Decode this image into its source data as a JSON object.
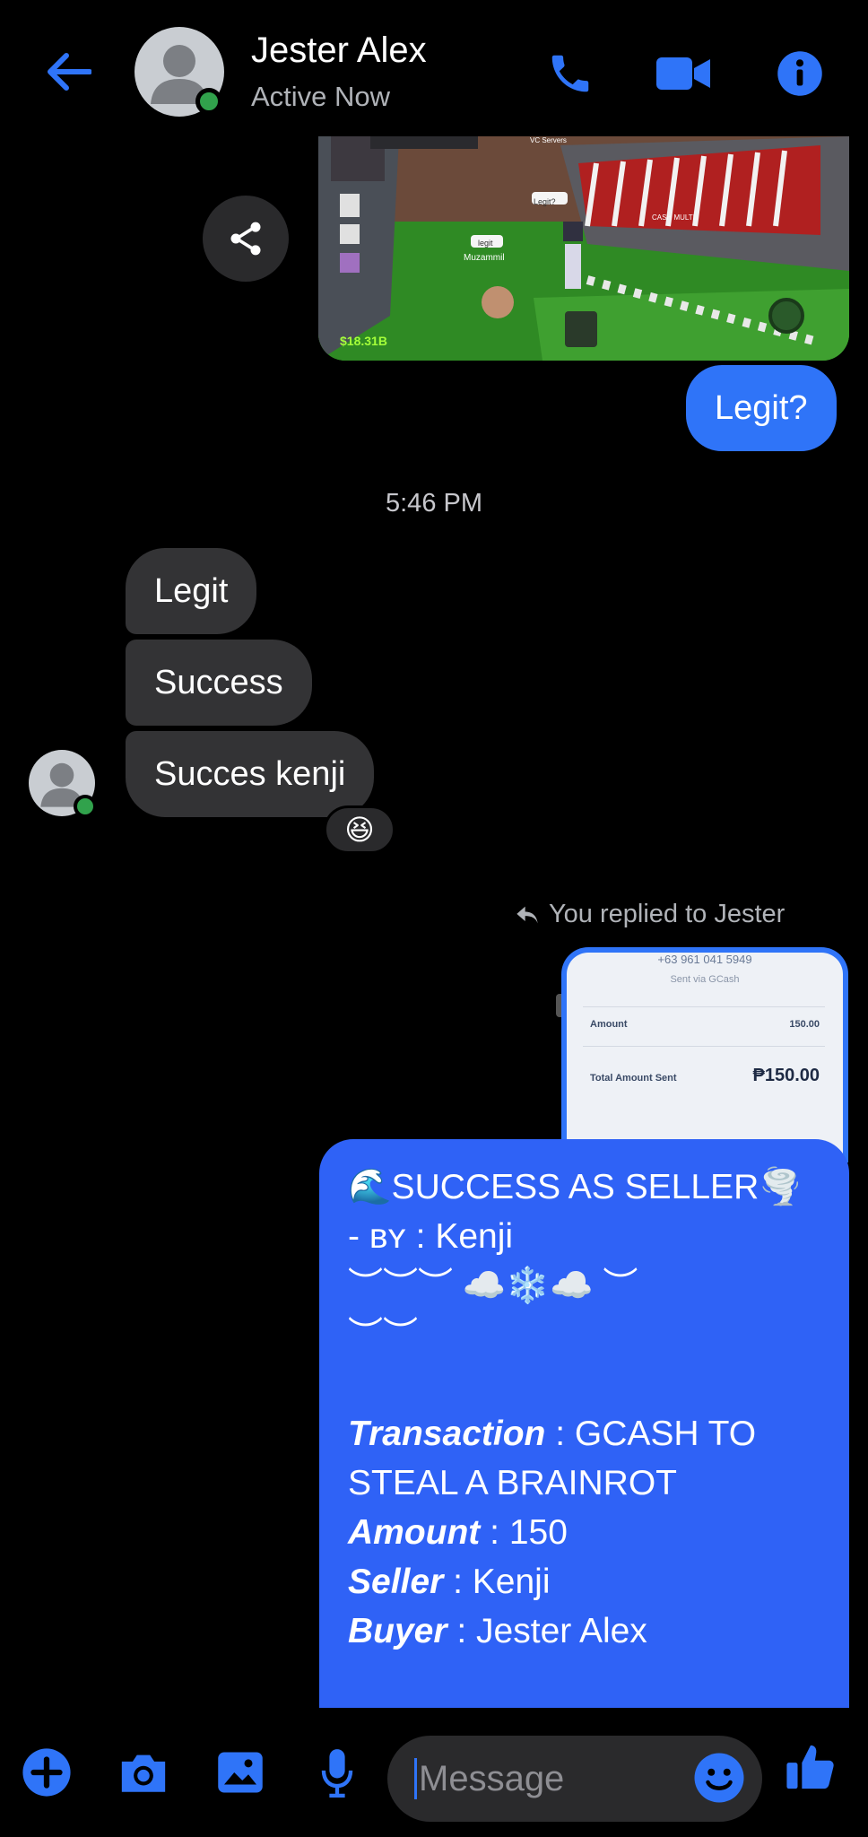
{
  "header": {
    "contact_name": "Jester Alex",
    "status": "Active Now"
  },
  "colors": {
    "accent": "#2f74f8",
    "incoming_bubble": "#333335",
    "presence": "#31a24c"
  },
  "game_image": {
    "labels": {
      "vc_servers": "VC Servers",
      "legit_sign": "legit",
      "player": "Muzammil",
      "legit_q": "Legit?",
      "cash": "$18.31B",
      "cash_multi": "CASH MULTI"
    }
  },
  "messages": {
    "outgoing_1": "Legit?",
    "timestamp": "5:46 PM",
    "incoming": [
      "Legit",
      "Success",
      "Succes kenji"
    ],
    "reaction": "😆",
    "reply_context": "You replied to Jester"
  },
  "receipt": {
    "phone": "+63 961 041 5949",
    "sent_via": "Sent via GCash",
    "amount_label": "Amount",
    "amount_value": "150.00",
    "total_label": "Total Amount Sent",
    "total_value": "₱150.00"
  },
  "big_message": {
    "title": "🌊SUCCESS AS SELLER🌪️",
    "by_prefix": "- ʙʏ : ",
    "by_name": "Kenji",
    "decor_1": "︶︶︶ ☁️❄️☁️ ︶",
    "decor_2": "︶︶",
    "transaction_label": "Transaction",
    "transaction_value": " : GCASH TO STEAL A BRAINROT",
    "amount_label": "Amount",
    "amount_value": " : 150",
    "seller_label": "Seller",
    "seller_value": " : Kenji",
    "buyer_label": "Buyer",
    "buyer_value": " : Jester Alex"
  },
  "composer": {
    "placeholder": "Message"
  }
}
